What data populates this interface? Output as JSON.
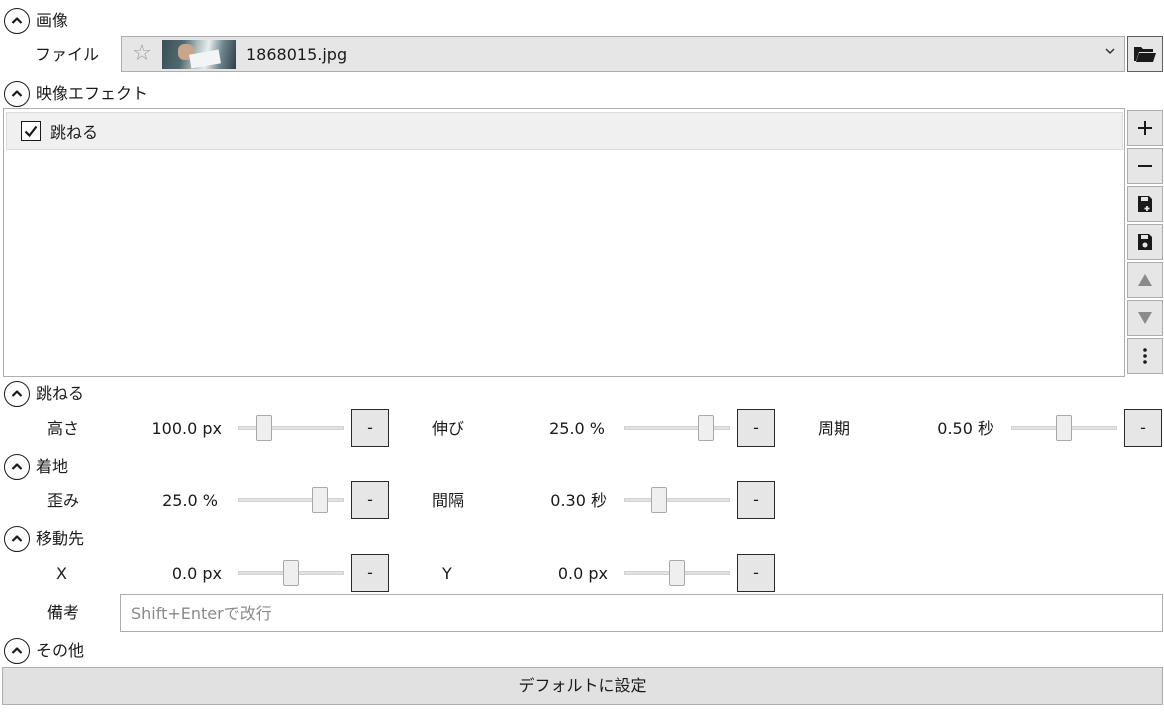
{
  "sections": {
    "image": {
      "title": "画像"
    },
    "video_effects": {
      "title": "映像エフェクト"
    },
    "bounce": {
      "title": "跳ねる"
    },
    "landing": {
      "title": "着地"
    },
    "destination": {
      "title": "移動先"
    },
    "other": {
      "title": "その他"
    }
  },
  "file": {
    "label": "ファイル",
    "filename": "1868015.jpg",
    "favorite_icon": "star-outline-icon",
    "dropdown_icon": "chevron-down-icon",
    "browse_icon": "folder-open-icon"
  },
  "effects": {
    "items": [
      {
        "name": "跳ねる",
        "checked": true
      }
    ],
    "side_buttons": [
      {
        "icon": "plus-icon"
      },
      {
        "icon": "minus-icon"
      },
      {
        "icon": "save-as-icon"
      },
      {
        "icon": "save-icon"
      },
      {
        "icon": "move-up-icon"
      },
      {
        "icon": "move-down-icon"
      },
      {
        "icon": "more-vertical-icon"
      }
    ]
  },
  "params": {
    "height": {
      "label": "高さ",
      "value": "100.0 px",
      "slider_level": 0.2,
      "btn": "-"
    },
    "stretch": {
      "label": "伸び",
      "value": "25.0 %",
      "slider_level": 0.82,
      "btn": "-"
    },
    "period": {
      "label": "周期",
      "value": "0.50 秒",
      "slider_level": 0.5,
      "btn": "-"
    },
    "distortion": {
      "label": "歪み",
      "value": "25.0 %",
      "slider_level": 0.82,
      "btn": "-"
    },
    "interval": {
      "label": "間隔",
      "value": "0.30 秒",
      "slider_level": 0.3,
      "btn": "-"
    },
    "x": {
      "label": "X",
      "value": "0.0 px",
      "slider_level": 0.5,
      "btn": "-"
    },
    "y": {
      "label": "Y",
      "value": "0.0 px",
      "slider_level": 0.5,
      "btn": "-"
    }
  },
  "memo": {
    "label": "備考",
    "placeholder": "Shift+Enterで改行"
  },
  "default_button": {
    "label": "デフォルトに設定"
  }
}
